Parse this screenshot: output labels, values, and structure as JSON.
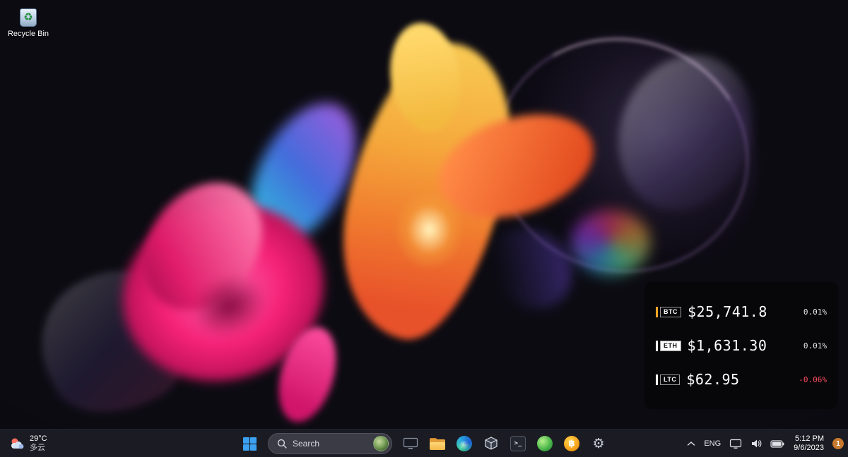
{
  "desktop": {
    "recycle_bin_label": "Recycle Bin"
  },
  "crypto_widget": {
    "rows": [
      {
        "symbol": "BTC",
        "price": "$25,741.8",
        "change": "0.01%",
        "bar_color": "#f5a623",
        "badge_bg": "transparent",
        "badge_color": "#ffffff",
        "change_color": "#e8e8e8"
      },
      {
        "symbol": "ETH",
        "price": "$1,631.30",
        "change": "0.01%",
        "bar_color": "#ffffff",
        "badge_bg": "#ffffff",
        "badge_color": "#111111",
        "change_color": "#e8e8e8"
      },
      {
        "symbol": "LTC",
        "price": "$62.95",
        "change": "-0.06%",
        "bar_color": "#ffffff",
        "badge_bg": "transparent",
        "badge_color": "#ffffff",
        "change_color": "#ff4d5e"
      }
    ]
  },
  "taskbar": {
    "weather": {
      "temp": "29°C",
      "condition": "多云"
    },
    "search": {
      "label": "Search"
    },
    "terminal_glyph": ">_",
    "bitcoin_glyph": "฿",
    "gear_glyph": "⚙",
    "recycle_glyph": "♻",
    "tray": {
      "language": "ENG",
      "time": "5:12 PM",
      "date": "9/6/2023",
      "notification_count": "1"
    }
  }
}
